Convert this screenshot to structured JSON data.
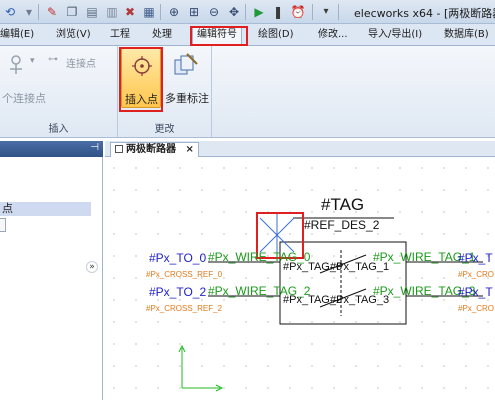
{
  "quick_access": {
    "title": "elecworks x64 - [两极断路器]"
  },
  "ribbon_tabs": [
    {
      "label": "编辑(E)"
    },
    {
      "label": "浏览(V)"
    },
    {
      "label": "工程"
    },
    {
      "label": "处理"
    },
    {
      "label": "编辑符号",
      "active": true
    },
    {
      "label": "绘图(D)"
    },
    {
      "label": "修改..."
    },
    {
      "label": "导入/导出(I)"
    },
    {
      "label": "数据库(B)"
    }
  ],
  "ribbon": {
    "connection_group": {
      "connection_point_label": "连接点",
      "multi_connection_label": "个连接点",
      "group_label": "插入"
    },
    "modify_group": {
      "insert_point_label": "插入点",
      "multi_annotation_label": "多重标注",
      "group_label": "更改"
    }
  },
  "left_panel": {
    "selected_item": "点"
  },
  "document": {
    "tab_label": "两极断路器",
    "close_glyph": "×"
  },
  "canvas": {
    "tag": "#TAG",
    "ref_des": "#REF_DES_2",
    "left_texts": {
      "px_to_0": "#Px_TO_0",
      "cross_ref_0": "#Px_CROSS_REF_0",
      "px_to_2": "#Px_TO_2",
      "cross_ref_2": "#Px_CROSS_REF_2"
    },
    "wire_tags": {
      "left_0": "#Px_WIRE_TAG_0",
      "left_2": "#Px_WIRE_TAG_2",
      "right_1": "#Px_WIRE_TAG_1",
      "right_3": "#Px_WIRE_TAG_3"
    },
    "inner_tags": {
      "tag_1": "#Px_TAG_1",
      "tag_3": "#Px_TAG_3",
      "tag_0": "#Px_TAG_0",
      "tag_2": "#Px_TAG_2"
    },
    "right_partial": {
      "px_t_1": "#Px_T",
      "cross_1": "#Px_CRO",
      "px_t_3": "#Px_T",
      "cross_3": "#Px_CRO"
    }
  },
  "colors": {
    "highlight_red": "#e02020",
    "blue_text": "#2222cc",
    "green_text": "#1a9a1a",
    "orange_text": "#e07a1a",
    "axis_green": "#22b822",
    "selected_point_blue": "#3a6fd8"
  }
}
